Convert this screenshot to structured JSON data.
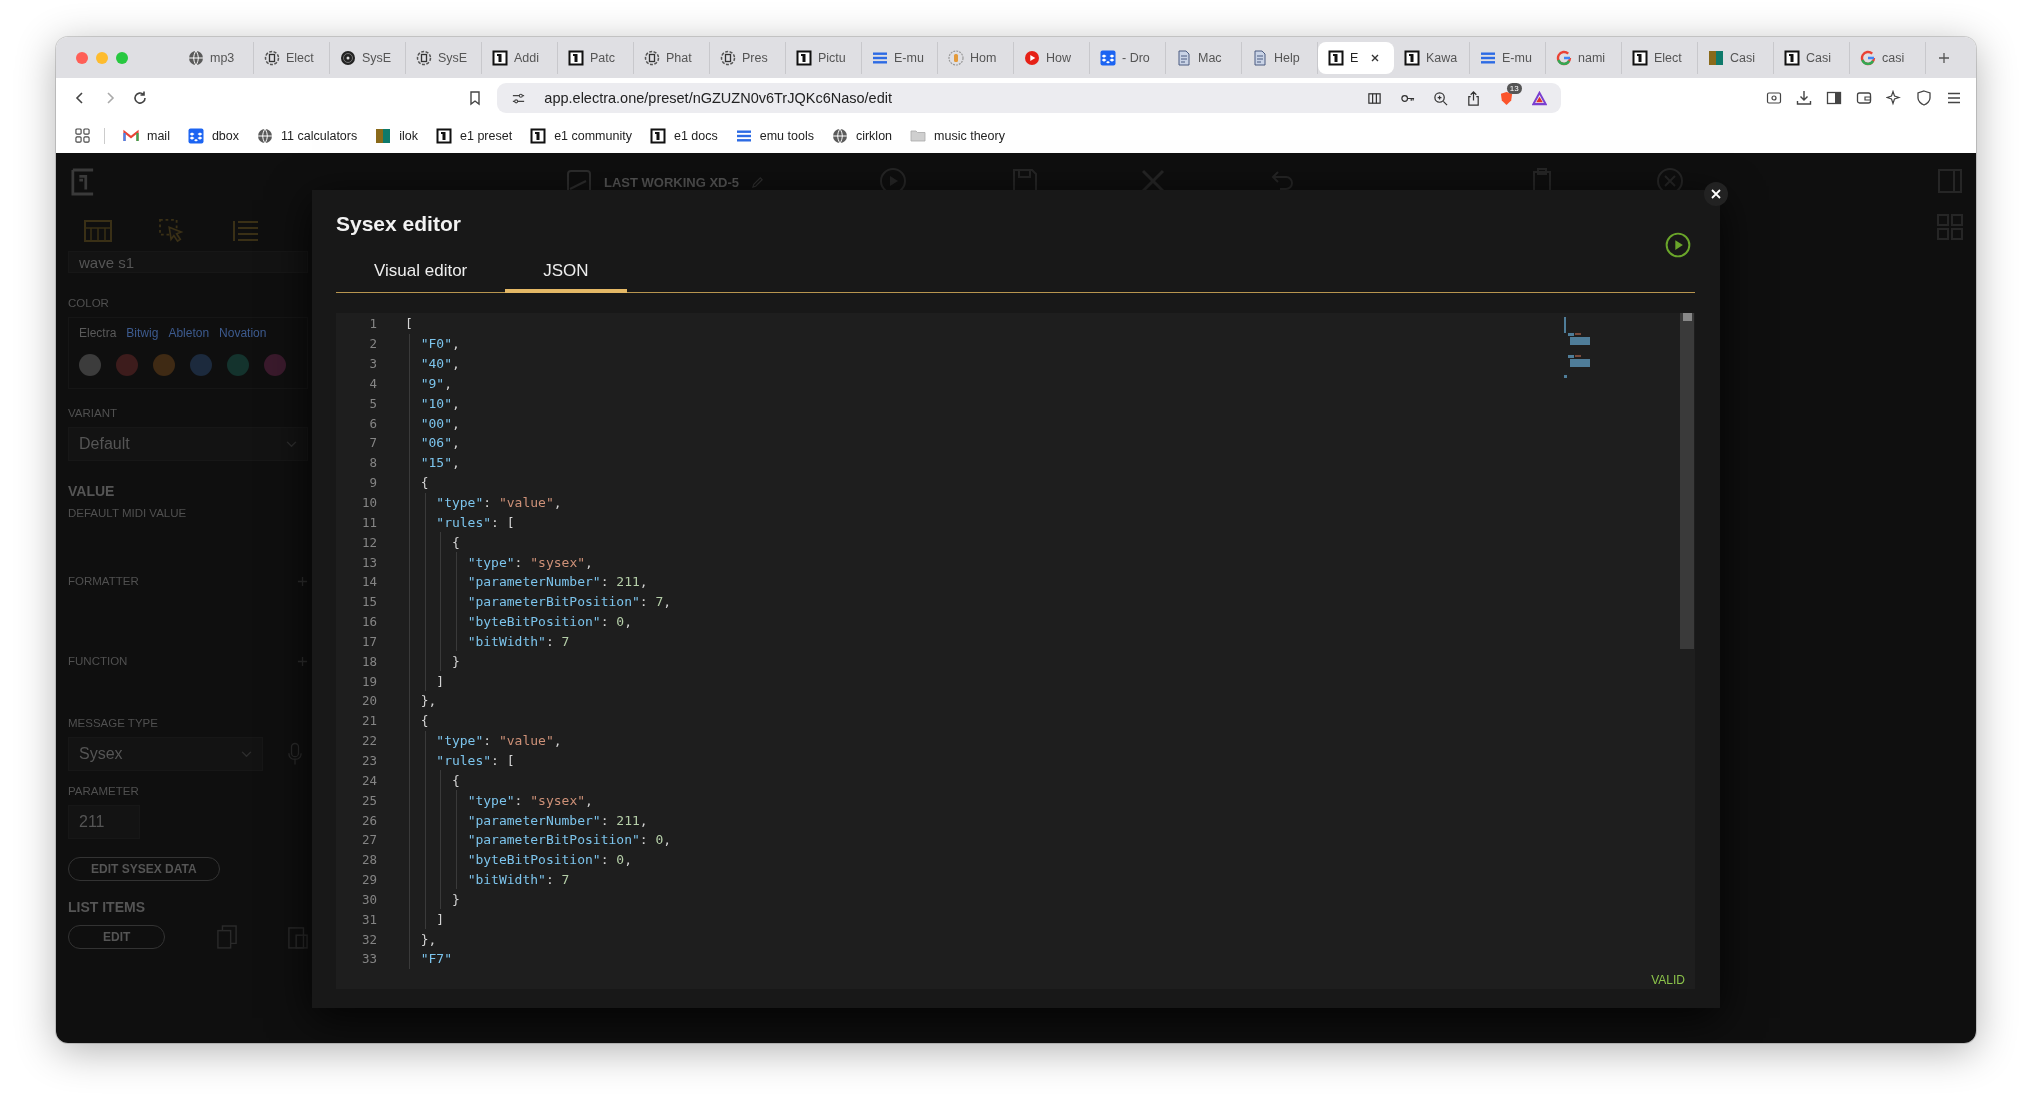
{
  "browser": {
    "tabs": [
      {
        "label": "mp3",
        "kind": "globe",
        "selected": false
      },
      {
        "label": "Elect",
        "kind": "ring",
        "selected": false
      },
      {
        "label": "SysE",
        "kind": "disc",
        "selected": false
      },
      {
        "label": "SysE",
        "kind": "ring",
        "selected": false
      },
      {
        "label": "Addi",
        "kind": "e1",
        "selected": false
      },
      {
        "label": "Patc",
        "kind": "e1",
        "selected": false
      },
      {
        "label": "Phat",
        "kind": "ring",
        "selected": false
      },
      {
        "label": "Pres",
        "kind": "ring",
        "selected": false
      },
      {
        "label": "Pictu",
        "kind": "e1",
        "selected": false
      },
      {
        "label": "E-mu",
        "kind": "lines",
        "selected": false
      },
      {
        "label": "Hom",
        "kind": "badge",
        "selected": false
      },
      {
        "label": "How",
        "kind": "play",
        "selected": false
      },
      {
        "label": "- Dro",
        "kind": "box",
        "selected": false
      },
      {
        "label": "Mac",
        "kind": "doc",
        "selected": false
      },
      {
        "label": "Help",
        "kind": "doc",
        "selected": false
      },
      {
        "label": "E",
        "kind": "e1",
        "selected": true
      },
      {
        "label": "Kawa",
        "kind": "e1",
        "selected": false
      },
      {
        "label": "E-mu",
        "kind": "lines",
        "selected": false
      },
      {
        "label": "nami",
        "kind": "g",
        "selected": false
      },
      {
        "label": "Elect",
        "kind": "e1",
        "selected": false
      },
      {
        "label": "Casi",
        "kind": "square",
        "selected": false
      },
      {
        "label": "Casi",
        "kind": "e1",
        "selected": false
      },
      {
        "label": "casi",
        "kind": "g",
        "selected": false
      }
    ],
    "url": "app.electra.one/preset/nGZUZN0v6TrJQKc6Naso/edit",
    "shields_count": "13",
    "bookmarks": [
      {
        "label": "mail",
        "kind": "mail"
      },
      {
        "label": "dbox",
        "kind": "box"
      },
      {
        "label": "11 calculators",
        "kind": "globe"
      },
      {
        "label": "ilok",
        "kind": "square"
      },
      {
        "label": "e1 preset",
        "kind": "e1"
      },
      {
        "label": "e1 community",
        "kind": "e1"
      },
      {
        "label": "e1 docs",
        "kind": "e1"
      },
      {
        "label": "emu tools",
        "kind": "lines"
      },
      {
        "label": "cirklon",
        "kind": "globe"
      },
      {
        "label": "music theory",
        "kind": "folder"
      }
    ]
  },
  "app": {
    "preset_name": "LAST WORKING XD-5",
    "sidebar": {
      "name_value": "wave s1",
      "color_label": "COLOR",
      "palettes": [
        {
          "label": "Electra",
          "selected": true
        },
        {
          "label": "Bitwig",
          "selected": false
        },
        {
          "label": "Ableton",
          "selected": false
        },
        {
          "label": "Novation",
          "selected": false
        }
      ],
      "swatches": [
        {
          "color": "#3c3c3c"
        },
        {
          "color": "#3d1c1c"
        },
        {
          "color": "#3f2a14"
        },
        {
          "color": "#1c2a3d"
        },
        {
          "color": "#14332d"
        },
        {
          "color": "#3a1a2c"
        }
      ],
      "variant_label": "VARIANT",
      "variant_value": "Default",
      "value_heading": "VALUE",
      "default_midi_label": "DEFAULT MIDI VALUE",
      "formatter_label": "FORMATTER",
      "function_label": "FUNCTION",
      "message_type_label": "MESSAGE TYPE",
      "message_type_value": "Sysex",
      "parameter_label": "PARAMETER",
      "parameter_value": "211",
      "edit_sysex_button": "EDIT SYSEX DATA",
      "list_items_heading": "LIST ITEMS",
      "edit_button": "EDIT"
    }
  },
  "modal": {
    "title": "Sysex editor",
    "tabs": [
      {
        "label": "Visual editor",
        "selected": false
      },
      {
        "label": "JSON",
        "selected": true
      }
    ],
    "code": [
      {
        "number": "1",
        "text": "["
      },
      {
        "number": "2",
        "text": "  \"F0\","
      },
      {
        "number": "3",
        "text": "  \"40\","
      },
      {
        "number": "4",
        "text": "  \"9\","
      },
      {
        "number": "5",
        "text": "  \"10\","
      },
      {
        "number": "6",
        "text": "  \"00\","
      },
      {
        "number": "7",
        "text": "  \"06\","
      },
      {
        "number": "8",
        "text": "  \"15\","
      },
      {
        "number": "9",
        "text": "  {"
      },
      {
        "number": "10",
        "text": "    \"type\": \"value\","
      },
      {
        "number": "11",
        "text": "    \"rules\": ["
      },
      {
        "number": "12",
        "text": "      {"
      },
      {
        "number": "13",
        "text": "        \"type\": \"sysex\","
      },
      {
        "number": "14",
        "text": "        \"parameterNumber\": 211,"
      },
      {
        "number": "15",
        "text": "        \"parameterBitPosition\": 7,"
      },
      {
        "number": "16",
        "text": "        \"byteBitPosition\": 0,"
      },
      {
        "number": "17",
        "text": "        \"bitWidth\": 7"
      },
      {
        "number": "18",
        "text": "      }"
      },
      {
        "number": "19",
        "text": "    ]"
      },
      {
        "number": "20",
        "text": "  },"
      },
      {
        "number": "21",
        "text": "  {"
      },
      {
        "number": "22",
        "text": "    \"type\": \"value\","
      },
      {
        "number": "23",
        "text": "    \"rules\": ["
      },
      {
        "number": "24",
        "text": "      {"
      },
      {
        "number": "25",
        "text": "        \"type\": \"sysex\","
      },
      {
        "number": "26",
        "text": "        \"parameterNumber\": 211,"
      },
      {
        "number": "27",
        "text": "        \"parameterBitPosition\": 0,"
      },
      {
        "number": "28",
        "text": "        \"byteBitPosition\": 0,"
      },
      {
        "number": "29",
        "text": "        \"bitWidth\": 7"
      },
      {
        "number": "30",
        "text": "      }"
      },
      {
        "number": "31",
        "text": "    ]"
      },
      {
        "number": "32",
        "text": "  },"
      },
      {
        "number": "33",
        "text": "  \"F7\""
      }
    ],
    "status": "VALID"
  }
}
